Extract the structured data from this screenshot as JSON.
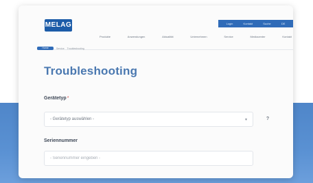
{
  "header": {
    "logo_text": "MELAG",
    "utility_links": [
      "Login",
      "Kontakt",
      "Suche",
      "DE"
    ],
    "nav_items": [
      "Produkte",
      "Anwendungen",
      "Aktualität",
      "Unternehmen",
      "Service",
      "Mediacenter",
      "Kontakt"
    ]
  },
  "breadcrumb": {
    "home": "Home",
    "items": [
      "Service",
      "Troubleshooting"
    ]
  },
  "page": {
    "title": "Troubleshooting"
  },
  "form": {
    "device_type_label": "Gerätetyp",
    "required_mark": "*",
    "device_type_value": "- Gerätetyp auswählen -",
    "help_icon": "?",
    "serial_label": "Seriennummer",
    "serial_placeholder": "- Seriennummer eingeben -",
    "serial_value": ""
  },
  "colors": {
    "brand_blue": "#1c5ca8",
    "title_blue": "#4a78b0",
    "background_band": "#5a91d3"
  }
}
